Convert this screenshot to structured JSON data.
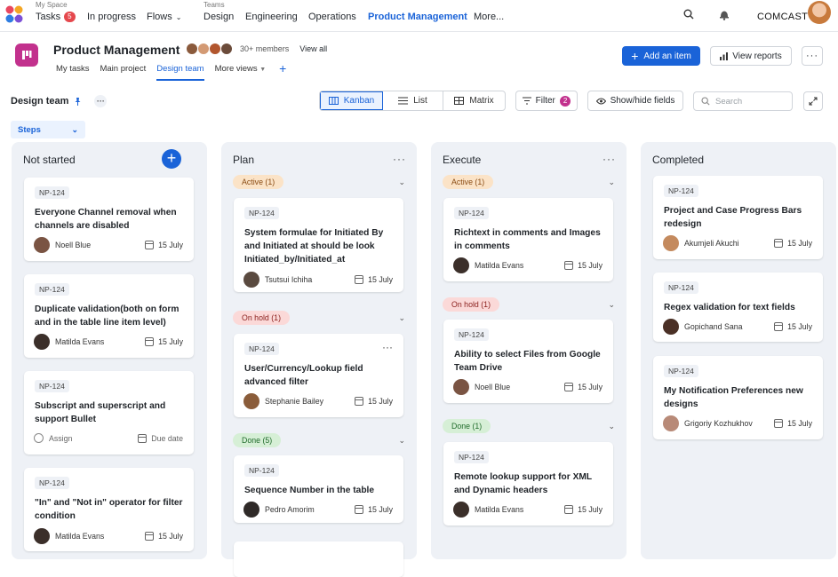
{
  "topnav": {
    "myspace_caption": "My Space",
    "teams_caption": "Teams",
    "tasks_label": "Tasks",
    "tasks_count": "5",
    "in_progress_label": "In progress",
    "flows_label": "Flows",
    "teams": [
      "Design",
      "Engineering",
      "Operations",
      "Product Management",
      "More..."
    ],
    "brand": "COMCAST"
  },
  "project": {
    "title": "Product Management",
    "members_text": "30+ members",
    "view_all": "View all",
    "tabs": [
      "My tasks",
      "Main project",
      "Design team",
      "More views"
    ],
    "add_item": "Add an item",
    "view_reports": "View reports"
  },
  "toolbar": {
    "team": "Design team",
    "views": [
      "Kanban",
      "List",
      "Matrix"
    ],
    "filter_label": "Filter",
    "filter_count": "2",
    "show_hide": "Show/hide fields",
    "search_placeholder": "Search",
    "group_by": "Steps"
  },
  "columns": [
    {
      "title": "Not started",
      "cards": [
        {
          "id": "NP-124",
          "title": "Everyone Channel removal when channels are disabled",
          "user": "Noell Blue",
          "date": "15 July"
        },
        {
          "id": "NP-124",
          "title": "Duplicate validation(both on form and in the table line item level)",
          "user": "Matilda Evans",
          "date": "15 July"
        },
        {
          "id": "NP-124",
          "title": "Subscript and superscript  and support Bullet",
          "user": "Assign",
          "date": "Due date"
        },
        {
          "id": "NP-124",
          "title": "\"In\" and \"Not in\" operator for filter condition",
          "user": "Matilda Evans",
          "date": "15 July"
        }
      ]
    },
    {
      "title": "Plan",
      "groups": [
        {
          "label": "Active (1)",
          "cards": [
            {
              "id": "NP-124",
              "title": "System formulae for Initiated By and Initiated at should be look Initiated_by/Initiated_at",
              "user": "Tsutsui Ichiha",
              "date": "15 July"
            }
          ]
        },
        {
          "label": "On hold (1)",
          "cards": [
            {
              "id": "NP-124",
              "title": "User/Currency/Lookup field advanced filter",
              "user": "Stephanie Bailey",
              "date": "15 July"
            }
          ]
        },
        {
          "label": "Done (5)",
          "cards": [
            {
              "id": "NP-124",
              "title": "Sequence Number in the table",
              "user": "Pedro Amorim",
              "date": "15 July"
            }
          ]
        }
      ]
    },
    {
      "title": "Execute",
      "groups": [
        {
          "label": "Active (1)",
          "cards": [
            {
              "id": "NP-124",
              "title": "Richtext in comments and Images in comments",
              "user": "Matilda Evans",
              "date": "15 July"
            }
          ]
        },
        {
          "label": "On hold (1)",
          "cards": [
            {
              "id": "NP-124",
              "title": "Ability to select Files from Google Team Drive",
              "user": "Noell Blue",
              "date": "15 July"
            }
          ]
        },
        {
          "label": "Done (1)",
          "cards": [
            {
              "id": "NP-124",
              "title": "Remote lookup support for XML and Dynamic headers",
              "user": "Matilda Evans",
              "date": "15 July"
            }
          ]
        }
      ]
    },
    {
      "title": "Completed",
      "cards": [
        {
          "id": "NP-124",
          "title": "Project and Case Progress Bars redesign",
          "user": "Akumjeli Akuchi",
          "date": "15 July"
        },
        {
          "id": "NP-124",
          "title": "Regex validation for text fields",
          "user": "Gopichand Sana",
          "date": "15 July"
        },
        {
          "id": "NP-124",
          "title": "My Notification Preferences new designs",
          "user": "Grigoriy Kozhukhov",
          "date": "15 July"
        }
      ]
    }
  ],
  "colors": {
    "accent": "#1a63d8",
    "brand_pink": "#c2318d",
    "badge_red": "#e5484d"
  }
}
